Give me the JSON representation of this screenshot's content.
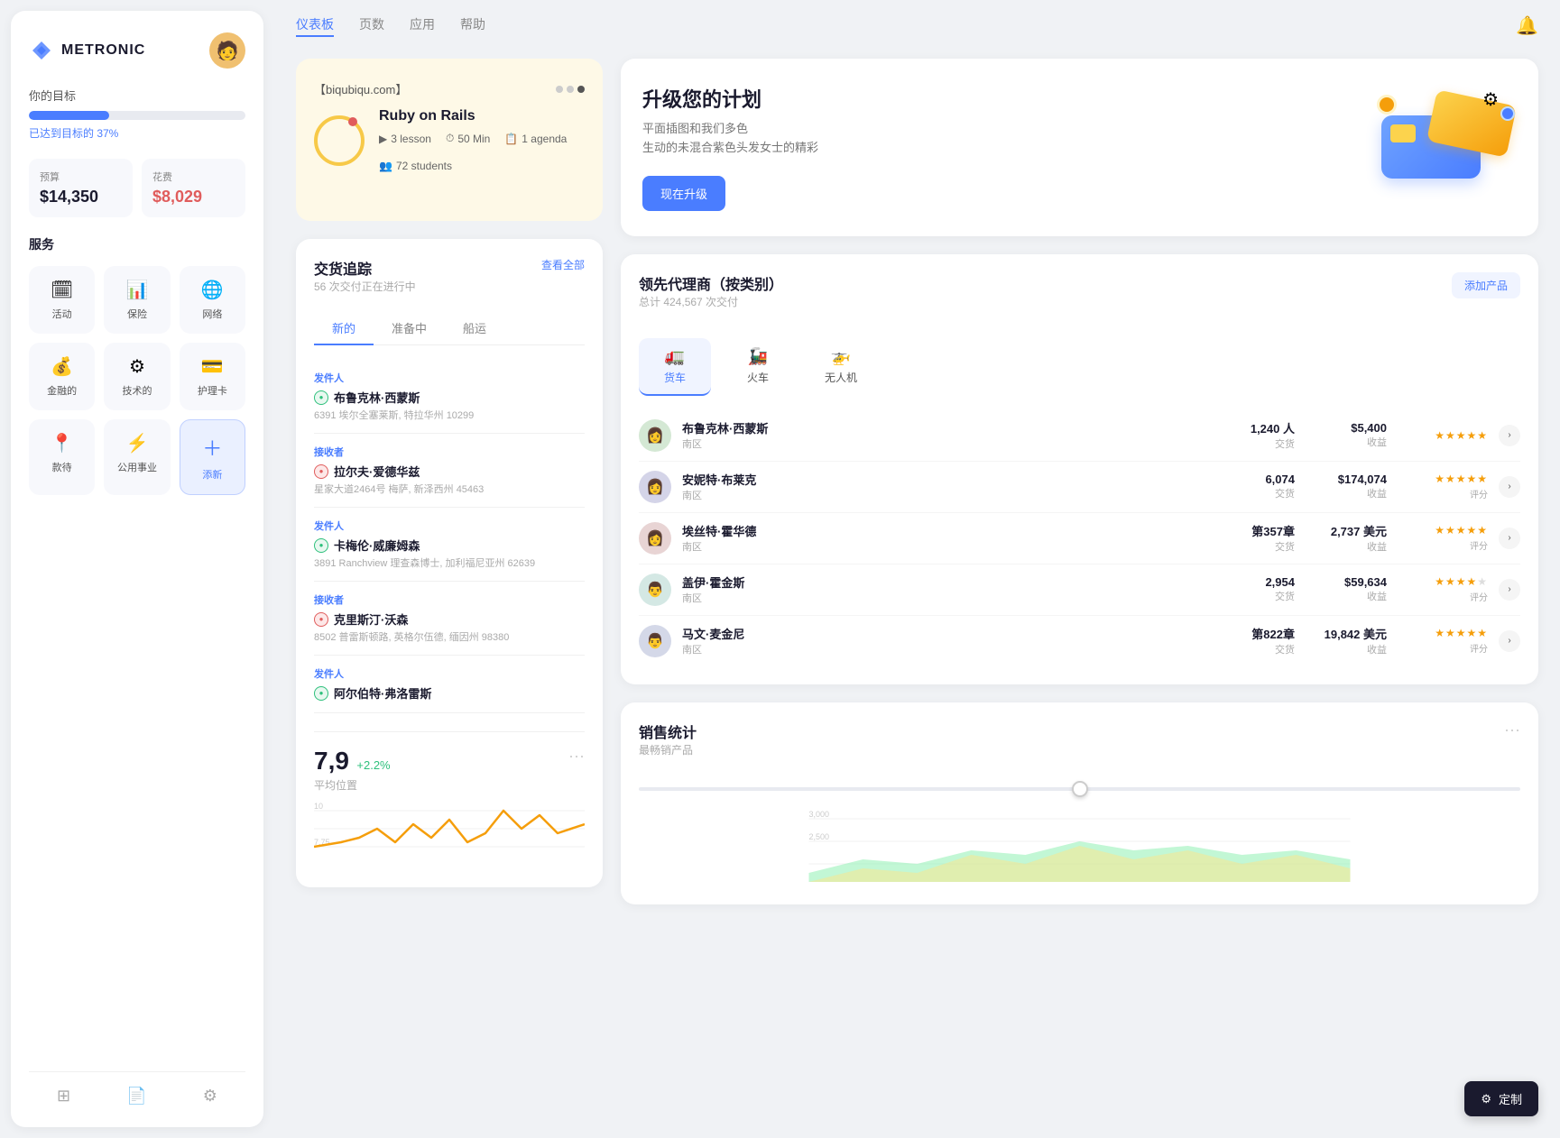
{
  "app": {
    "name": "METRONIC"
  },
  "sidebar": {
    "goal_label": "你的目标",
    "goal_pct": 37,
    "goal_text": "已达到目标的 37%",
    "budget": {
      "label": "预算",
      "value": "$14,350"
    },
    "expense": {
      "label": "花费",
      "value": "$8,029"
    },
    "services_label": "服务",
    "services": [
      {
        "icon": "🗓",
        "name": "活动",
        "active": false
      },
      {
        "icon": "📊",
        "name": "保险",
        "active": false
      },
      {
        "icon": "🌐",
        "name": "网络",
        "active": false
      },
      {
        "icon": "💰",
        "name": "金融的",
        "active": false
      },
      {
        "icon": "⚙",
        "name": "技术的",
        "active": false
      },
      {
        "icon": "💳",
        "name": "护理卡",
        "active": false
      },
      {
        "icon": "📍",
        "name": "款待",
        "active": false
      },
      {
        "icon": "⚡",
        "name": "公用事业",
        "active": false
      },
      {
        "icon": "+",
        "name": "添新",
        "active": true,
        "isAdd": true
      }
    ],
    "footer_icons": [
      "layers",
      "file",
      "settings"
    ]
  },
  "nav": {
    "links": [
      "仪表板",
      "页数",
      "应用",
      "帮助"
    ],
    "active": "仪表板"
  },
  "course_card": {
    "url": "【biqubiqu.com】",
    "title": "Ruby on Rails",
    "lessons": "3 lesson",
    "duration": "50 Min",
    "agenda": "1 agenda",
    "students": "72 students"
  },
  "upgrade_card": {
    "title": "升级您的计划",
    "desc_line1": "平面插图和我们多色",
    "desc_line2": "生动的未混合紫色头发女士的精彩",
    "btn_label": "现在升级"
  },
  "tracking": {
    "title": "交货追踪",
    "subtitle": "56 次交付正在进行中",
    "view_all": "查看全部",
    "tabs": [
      "新的",
      "准备中",
      "船运"
    ],
    "active_tab": "新的",
    "items": [
      {
        "role": "发件人",
        "name": "布鲁克林·西蒙斯",
        "addr": "6391 埃尔全塞莱斯, 特拉华州 10299",
        "type": "sender"
      },
      {
        "role": "接收者",
        "name": "拉尔夫·爱德华兹",
        "addr": "星家大道2464号 梅萨, 新泽西州 45463",
        "type": "receiver"
      },
      {
        "role": "发件人",
        "name": "卡梅伦·威廉姆森",
        "addr": "3891 Ranchview 理查森博士, 加利福尼亚州 62639",
        "type": "sender"
      },
      {
        "role": "接收者",
        "name": "克里斯汀·沃森",
        "addr": "8502 普雷斯顿路, 英格尔伍德, 缅因州 98380",
        "type": "receiver"
      },
      {
        "role": "发件人",
        "name": "阿尔伯特·弗洛雷斯",
        "addr": "",
        "type": "sender"
      }
    ]
  },
  "agents": {
    "title": "领先代理商（按类别）",
    "subtitle": "总计 424,567 次交付",
    "add_btn": "添加产品",
    "tabs": [
      "货车",
      "火车",
      "无人机"
    ],
    "active_tab": "货车",
    "rows": [
      {
        "name": "布鲁克林·西蒙斯",
        "region": "南区",
        "transactions": "1,240 人",
        "trans_label": "交货",
        "revenue": "$5,400",
        "rev_label": "收益",
        "stars": 5,
        "rating_label": "",
        "avatar_color": "av1"
      },
      {
        "name": "安妮特·布莱克",
        "region": "南区",
        "transactions": "6,074",
        "trans_label": "交货",
        "revenue": "$174,074",
        "rev_label": "收益",
        "stars": 5,
        "rating_label": "评分",
        "avatar_color": "av2"
      },
      {
        "name": "埃丝特·霍华德",
        "region": "南区",
        "transactions": "第357章",
        "trans_label": "交货",
        "revenue": "2,737 美元",
        "rev_label": "收益",
        "stars": 5,
        "rating_label": "评分",
        "avatar_color": "av3"
      },
      {
        "name": "盖伊·霍金斯",
        "region": "南区",
        "transactions": "2,954",
        "trans_label": "交货",
        "revenue": "$59,634",
        "rev_label": "收益",
        "stars": 4,
        "rating_label": "评分",
        "avatar_color": "av4"
      },
      {
        "name": "马文·麦金尼",
        "region": "南区",
        "transactions": "第822章",
        "trans_label": "交货",
        "revenue": "19,842 美元",
        "rev_label": "收益",
        "stars": 5,
        "rating_label": "评分",
        "avatar_color": "av5"
      }
    ]
  },
  "stats": {
    "value": "7,9",
    "pct": "+2.2%",
    "label": "平均位置",
    "more_dots": "···"
  },
  "sales": {
    "title": "销售统计",
    "subtitle": "最畅销产品",
    "more_dots": "···"
  },
  "customize": {
    "btn_label": "定制"
  }
}
